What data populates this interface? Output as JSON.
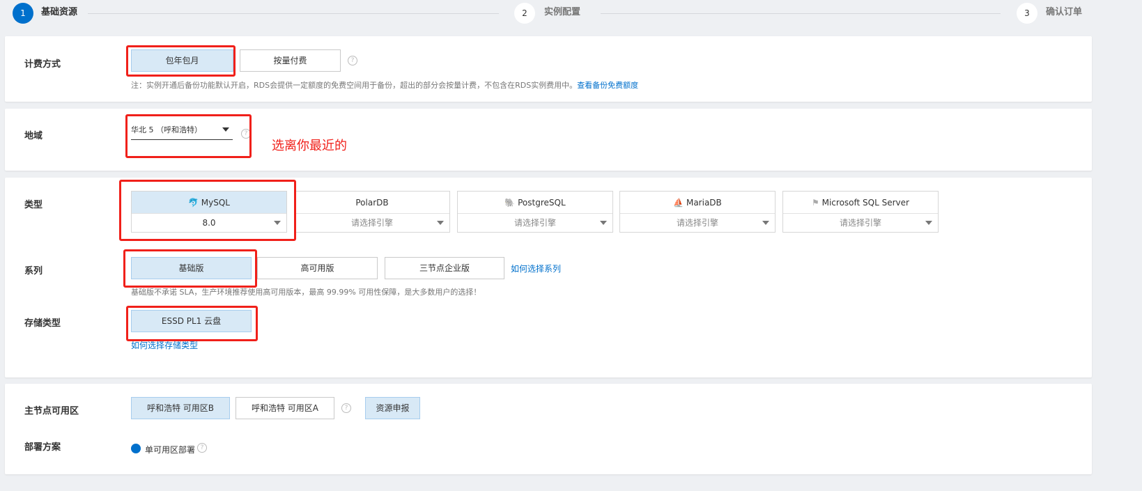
{
  "steps": [
    {
      "num": "1",
      "label": "基础资源",
      "active": true
    },
    {
      "num": "2",
      "label": "实例配置"
    },
    {
      "num": "3",
      "label": "确认订单"
    }
  ],
  "billing": {
    "label": "计费方式",
    "options": [
      "包年包月",
      "按量付费"
    ],
    "selected": "包年包月",
    "note": "注：实例开通后备份功能默认开启，RDS会提供一定额度的免费空间用于备份，超出的部分会按量计费，不包含在RDS实例费用中。",
    "note_link": "查看备份免费额度"
  },
  "region": {
    "label": "地域",
    "value": "华北 5 （呼和浩特）",
    "annotation": "选离你最近的"
  },
  "type": {
    "label": "类型",
    "engines": [
      {
        "name": "MySQL",
        "icon": "mysql-dolphin-icon",
        "version": "8.0",
        "selected": true
      },
      {
        "name": "PolarDB",
        "version": "请选择引擎"
      },
      {
        "name": "PostgreSQL",
        "icon": "postgresql-elephant-icon",
        "version": "请选择引擎"
      },
      {
        "name": "MariaDB",
        "icon": "mariadb-seal-icon",
        "version": "请选择引擎"
      },
      {
        "name": "Microsoft SQL Server",
        "icon": "sqlserver-icon",
        "version": "请选择引擎"
      }
    ]
  },
  "series": {
    "label": "系列",
    "options": [
      "基础版",
      "高可用版",
      "三节点企业版"
    ],
    "selected": "基础版",
    "link": "如何选择系列",
    "note": "基础版不承诺 SLA，生产环境推荐使用高可用版本，最高 99.99% 可用性保障，是大多数用户的选择！"
  },
  "storage": {
    "label": "存储类型",
    "options": [
      "ESSD PL1 云盘"
    ],
    "selected": "ESSD PL1 云盘",
    "link": "如何选择存储类型"
  },
  "zone": {
    "label": "主节点可用区",
    "options": [
      "呼和浩特 可用区B",
      "呼和浩特 可用区A"
    ],
    "selected": "呼和浩特 可用区B",
    "report": "资源申报"
  },
  "deploy": {
    "label": "部署方案",
    "option": "单可用区部署"
  },
  "colors": {
    "accent": "#0070cc",
    "selected_bg": "#d8e9f6",
    "annotation": "#f0201a"
  }
}
